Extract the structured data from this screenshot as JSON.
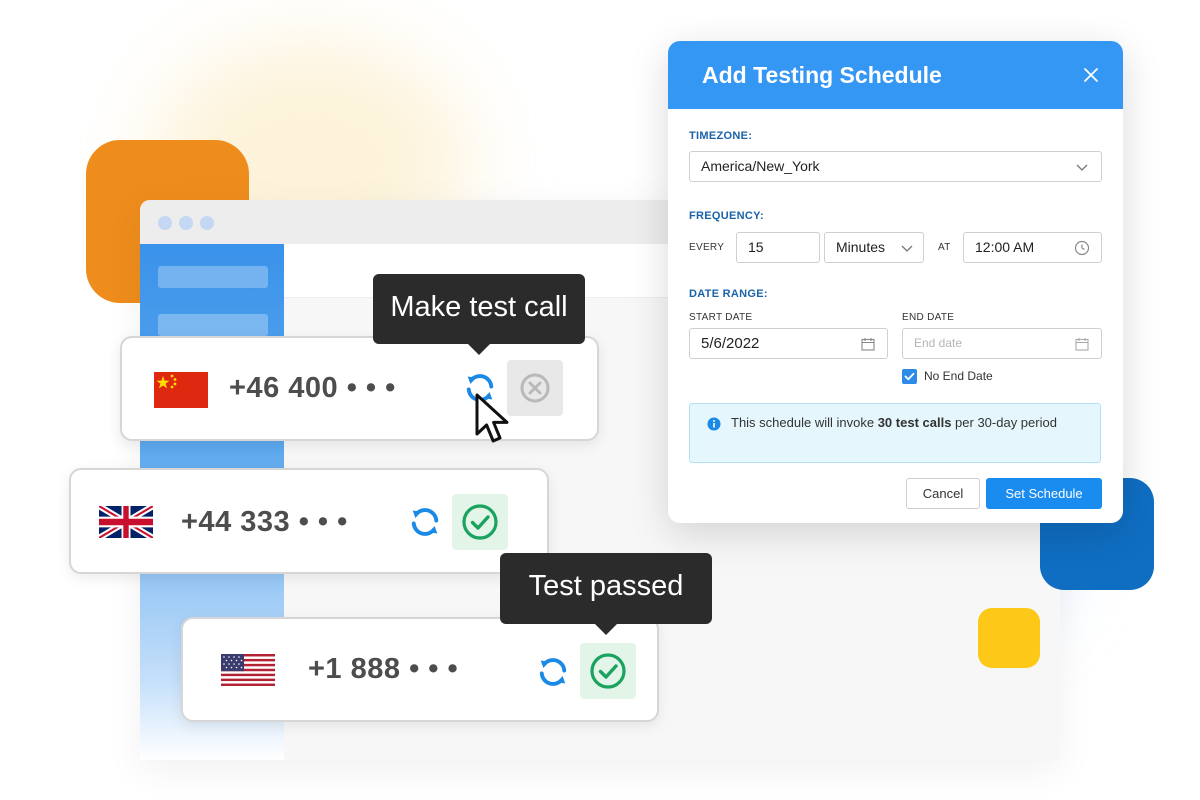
{
  "tooltips": {
    "make_call": "Make test call",
    "passed": "Test passed"
  },
  "cards": [
    {
      "country": "China",
      "number": "+46 400 • • •",
      "status": "not-tested"
    },
    {
      "country": "United Kingdom",
      "number": "+44 333 • • •",
      "status": "passed"
    },
    {
      "country": "United States",
      "number": "+1 888 • • •",
      "status": "passed"
    }
  ],
  "dialog": {
    "title": "Add Testing Schedule",
    "timezone_label": "TIMEZONE:",
    "timezone_value": "America/New_York",
    "frequency_label": "FREQUENCY:",
    "every_label": "EVERY",
    "every_value": "15",
    "unit_value": "Minutes",
    "at_label": "AT",
    "time_value": "12:00 AM",
    "date_range_label": "DATE RANGE:",
    "start_date_label": "START DATE",
    "start_date_value": "5/6/2022",
    "end_date_label": "END DATE",
    "end_date_placeholder": "End date",
    "no_end_date_label": "No End Date",
    "no_end_date_checked": true,
    "info_prefix": "This schedule will invoke",
    "info_bold": "30 test calls",
    "info_suffix": "per 30-day period",
    "cancel_label": "Cancel",
    "submit_label": "Set Schedule"
  },
  "colors": {
    "accent": "#3497f3",
    "primary_button": "#1a8cf0",
    "success": "#1aa35f",
    "success_bg": "#e3f5e9",
    "refresh": "#1a8ae6",
    "orange": "#ee8d1c",
    "navy": "#0f6ec2",
    "yellow": "#fdc817"
  }
}
